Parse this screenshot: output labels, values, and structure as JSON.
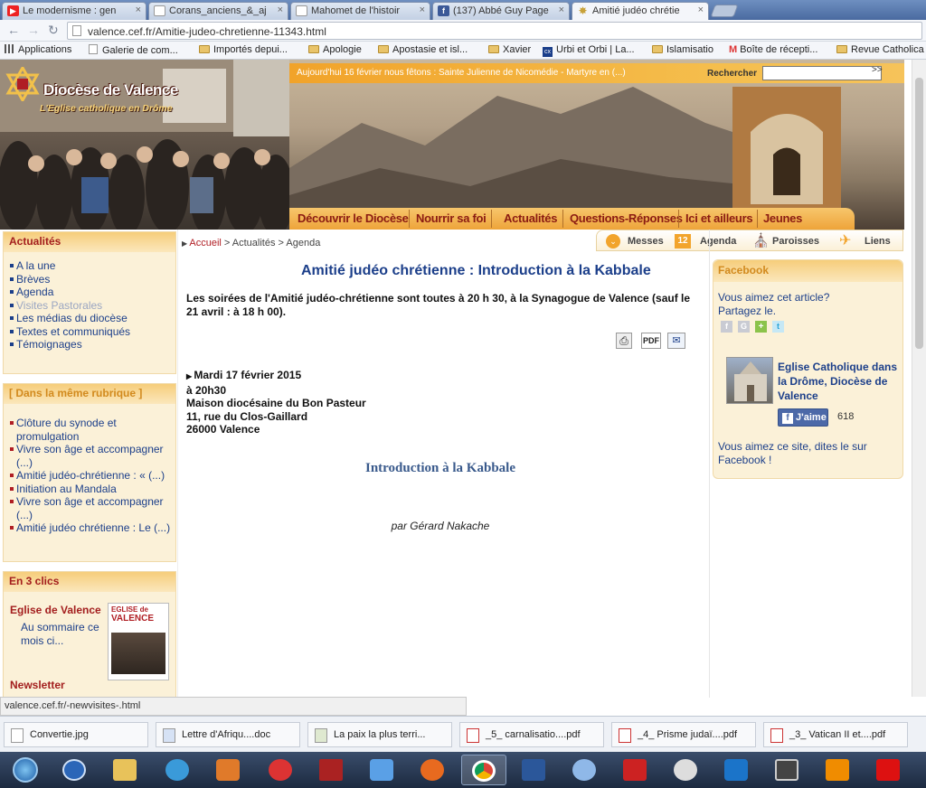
{
  "tabs": [
    {
      "label": "Le modernisme : gen",
      "icon": "youtube-icon",
      "color": "#e22"
    },
    {
      "label": "Corans_anciens_&_aj",
      "icon": "page-icon",
      "color": "#ddd"
    },
    {
      "label": "Mahomet de l'histoir",
      "icon": "page-icon",
      "color": "#ddd"
    },
    {
      "label": "(137) Abbé Guy Page",
      "icon": "facebook-icon",
      "color": "#3b5998"
    },
    {
      "label": "Amitié judéo chrétie",
      "icon": "star-icon",
      "color": "#c8a23a"
    }
  ],
  "address": {
    "url": "valence.cef.fr/Amitie-judeo-chretienne-11343.html"
  },
  "bookmarks": [
    {
      "label": "Applications"
    },
    {
      "label": "Galerie de com..."
    },
    {
      "label": "Importés depui..."
    },
    {
      "label": "Apologie"
    },
    {
      "label": "Apostasie et isl..."
    },
    {
      "label": "Xavier"
    },
    {
      "label": "Urbi et Orbi | La..."
    },
    {
      "label": "Islamisatio"
    },
    {
      "label": "Boîte de récepti..."
    },
    {
      "label": "Revue Catholica"
    }
  ],
  "header": {
    "logo_title": "Diocèse de Valence",
    "logo_subtitle": "L'Eglise catholique en Drôme",
    "ticker": "Aujourd'hui 16 février nous fêtons : Sainte Julienne de Nicomédie - Martyre en (...)",
    "search_label": "Rechercher",
    "search_go": ">>",
    "nav": [
      "Découvrir le Diocèse",
      "Nourrir sa foi",
      "Actualités",
      "Questions-Réponses",
      "Ici et ailleurs",
      "Jeunes"
    ]
  },
  "breadcrumb": {
    "home": "Accueil",
    "rest": " > Actualités > Agenda"
  },
  "quicklinks": [
    {
      "label": "Messes",
      "icon": "chevron-down-icon"
    },
    {
      "label": "Agenda",
      "icon": "calendar-icon",
      "num": "12"
    },
    {
      "label": "Paroisses",
      "icon": "church-icon"
    },
    {
      "label": "Liens",
      "icon": "plane-icon"
    }
  ],
  "left": {
    "actualites_title": "Actualités",
    "actualites_items": [
      "A la une",
      "Brèves",
      "Agenda",
      "Visites Pastorales",
      "Les médias du diocèse",
      "Textes et communiqués",
      "Témoignages"
    ],
    "rubrique_title": "[ Dans la même rubrique ]",
    "rubrique_items": [
      "Clôture du synode et promulgation",
      "Vivre son âge et accompagner (...)",
      "Amitié judéo-chrétienne : « (...)",
      "Initiation au Mandala",
      "Vivre son âge et accompagner (...)",
      "Amitié judéo chrétienne : Le (...)"
    ],
    "clics_title": "En 3 clics",
    "eglise_title": "Eglise de Valence",
    "eglise_link": "Au sommaire ce mois ci...",
    "magazine_line1": "EGLISE de",
    "magazine_line2": "VALENCE",
    "newsletter_title": "Newsletter"
  },
  "article": {
    "title": "Amitié judéo chrétienne : Introduction à la Kabbale",
    "intro": "Les soirées de l'Amitié judéo-chrétienne sont toutes à 20 h 30, à la Synagogue de Valence (sauf le 21 avril : à 18 h 00).",
    "tools": {
      "pdf": "PDF"
    },
    "date": "Mardi 17 février 2015",
    "time": "à 20h30",
    "place1": "Maison diocésaine du Bon Pasteur",
    "place2": "11, rue du Clos-Gaillard",
    "place3": "26000 Valence",
    "subtitle": "Introduction à la Kabbale",
    "author": "par Gérard Nakache"
  },
  "facebook": {
    "title": "Facebook",
    "line1": "Vous aimez cet article?",
    "line2": "Partagez le.",
    "page_name": "Eglise Catholique dans la Drôme, Diocèse de Valence",
    "like_label": "J'aime",
    "like_count": "618",
    "footer": "Vous aimez ce site, dites le sur Facebook !"
  },
  "status": {
    "url": "valence.cef.fr/-newvisites-.html"
  },
  "downloads": [
    {
      "label": "Convertie.jpg"
    },
    {
      "label": "Lettre d'Afriqu....doc"
    },
    {
      "label": "La paix la plus terri..."
    },
    {
      "label": "_5_ carnalisatio....pdf"
    },
    {
      "label": "_4_ Prisme judaï....pdf"
    },
    {
      "label": "_3_ Vatican II et....pdf"
    }
  ],
  "colors": {
    "accent": "#1c3f8a",
    "red": "#b01e24",
    "orange": "#f1a32a"
  }
}
